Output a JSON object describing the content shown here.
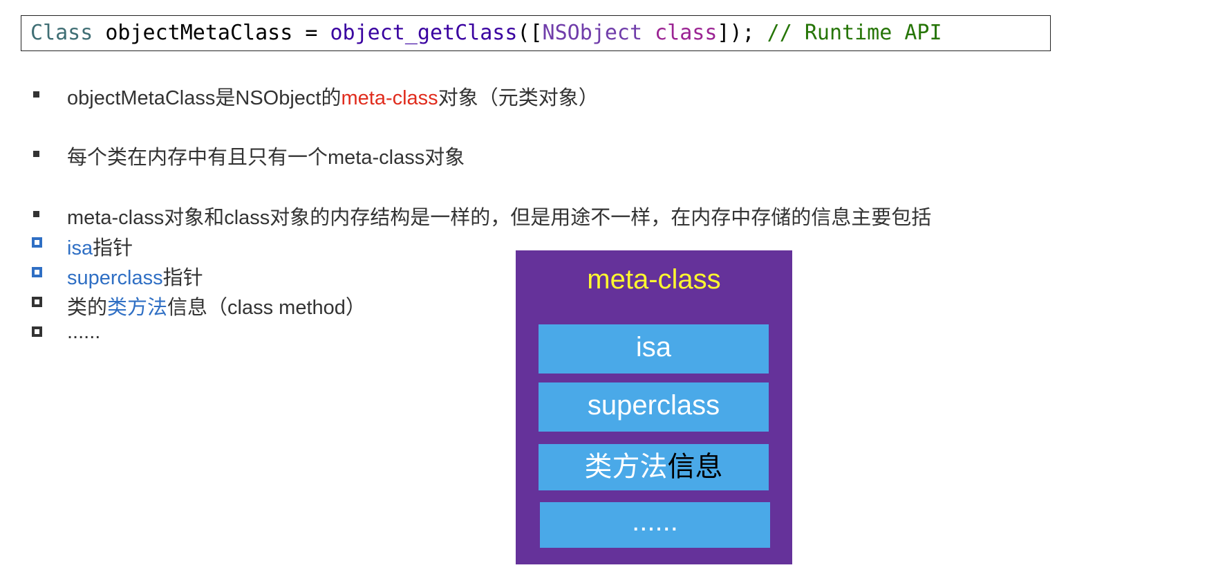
{
  "code": {
    "type_kw": "Class",
    "var_assign": " objectMetaClass = ",
    "func": "object_getClass",
    "open": "([",
    "cls": "NSObject",
    "space": " ",
    "kw": "class",
    "close": "]); ",
    "comment": "// Runtime API"
  },
  "bullets": {
    "b1_prefix": "objectMetaClass是NSObject的",
    "b1_highlight": "meta-class",
    "b1_suffix": "对象（元类对象）",
    "b2": "每个类在内存中有且只有一个meta-class对象",
    "b3": "meta-class对象和class对象的内存结构是一样的，但是用途不一样，在内存中存储的信息主要包括"
  },
  "sub_items": {
    "i1_highlight": "isa",
    "i1_suffix": "指针",
    "i2_highlight": "superclass",
    "i2_suffix": "指针",
    "i3_prefix": "类的",
    "i3_highlight": "类方法",
    "i3_suffix": "信息（class method）",
    "i4": "......"
  },
  "diagram": {
    "title": "meta-class",
    "cell_isa": "isa",
    "cell_superclass": "superclass",
    "cell_methods_light": "类方法",
    "cell_methods_dark": "信息",
    "cell_more": "......"
  },
  "colors": {
    "panel": "#65329a",
    "cell": "#4aa9e8",
    "title": "#fff82f",
    "highlight_red": "#e02c1d",
    "highlight_blue": "#2f6fc4"
  }
}
